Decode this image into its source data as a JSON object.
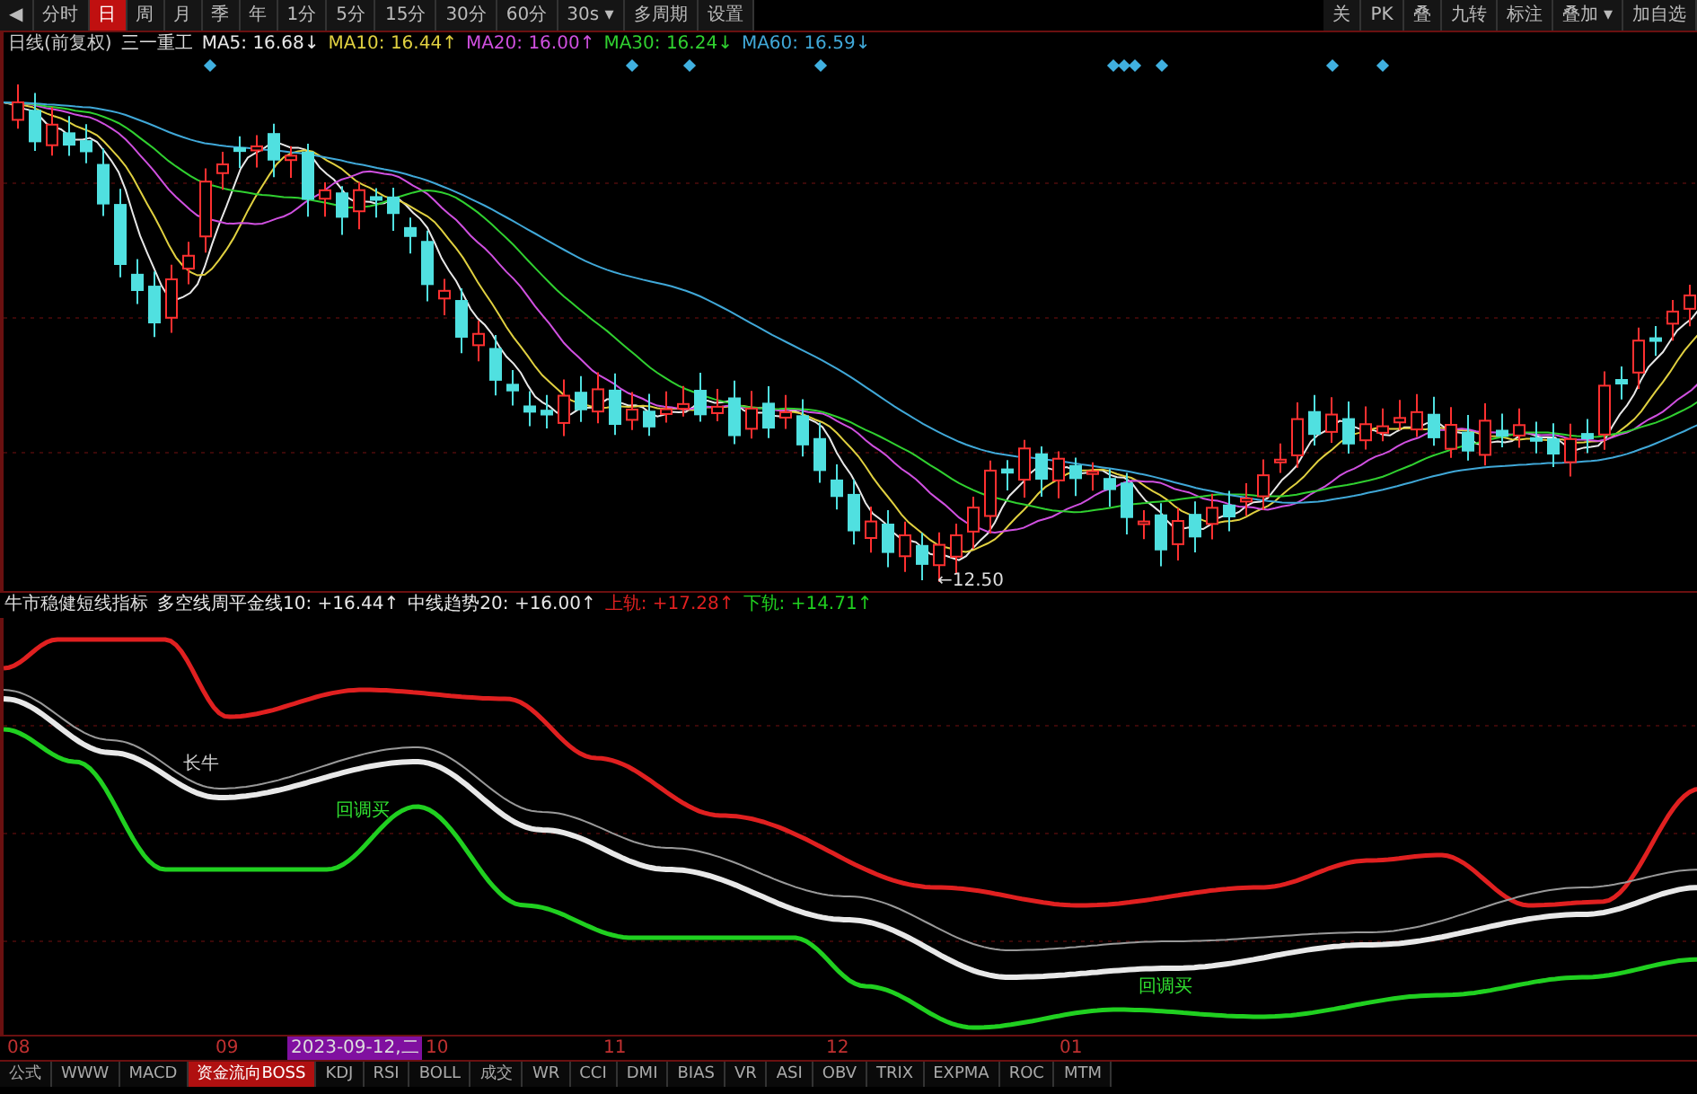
{
  "toolbar": {
    "left": [
      {
        "label": "◀",
        "selected": false
      },
      {
        "label": "分时",
        "selected": false
      },
      {
        "label": "日",
        "selected": true
      },
      {
        "label": "周",
        "selected": false
      },
      {
        "label": "月",
        "selected": false
      },
      {
        "label": "季",
        "selected": false
      },
      {
        "label": "年",
        "selected": false
      },
      {
        "label": "1分",
        "selected": false
      },
      {
        "label": "5分",
        "selected": false
      },
      {
        "label": "15分",
        "selected": false
      },
      {
        "label": "30分",
        "selected": false
      },
      {
        "label": "60分",
        "selected": false
      },
      {
        "label": "30s ▾",
        "selected": false
      },
      {
        "label": "多周期",
        "selected": false
      },
      {
        "label": "设置",
        "selected": false
      }
    ],
    "right": [
      "关",
      "PK",
      "叠",
      "九转",
      "标注",
      "叠加 ▾",
      "加自选"
    ]
  },
  "main_legend": {
    "mode": "日线(前复权)",
    "stock": "三一重工",
    "mas": [
      {
        "label": "MA5: 16.68",
        "arrow": "↓",
        "color": "#e8e8e8"
      },
      {
        "label": "MA10: 16.44",
        "arrow": "↑",
        "color": "#e0d040"
      },
      {
        "label": "MA20: 16.00",
        "arrow": "↑",
        "color": "#d050e0"
      },
      {
        "label": "MA30: 16.24",
        "arrow": "↓",
        "color": "#30d030"
      },
      {
        "label": "MA60: 16.59",
        "arrow": "↓",
        "color": "#40a8d8"
      }
    ]
  },
  "main_chart": {
    "low_label": "←12.50"
  },
  "indicator_legend": {
    "title": "牛市稳健短线指标",
    "items": [
      {
        "label": "多空线周平金线10: +16.44",
        "arrow": "↑",
        "color": "#e8e8e8"
      },
      {
        "label": "中线趋势20: +16.00",
        "arrow": "↑",
        "color": "#e8e8e8"
      },
      {
        "label": "上轨: +17.28",
        "arrow": "↑",
        "color": "#e02020"
      },
      {
        "label": "下轨: +14.71",
        "arrow": "↑",
        "color": "#20d020"
      }
    ]
  },
  "indicator_chart": {
    "annotations": [
      "长牛",
      "回调买",
      "回调买"
    ]
  },
  "x_axis": {
    "labels": [
      "08",
      "09",
      "10",
      "11",
      "12",
      "01"
    ],
    "cursor_date": "2023-09-12,二"
  },
  "bottom_tabs": [
    {
      "label": "公式",
      "selected": false
    },
    {
      "label": "WWW",
      "selected": false
    },
    {
      "label": "MACD",
      "selected": false
    },
    {
      "label": "资金流向BOSS",
      "selected": true
    },
    {
      "label": "KDJ",
      "selected": false
    },
    {
      "label": "RSI",
      "selected": false
    },
    {
      "label": "BOLL",
      "selected": false
    },
    {
      "label": "成交",
      "selected": false
    },
    {
      "label": "WR",
      "selected": false
    },
    {
      "label": "CCI",
      "selected": false
    },
    {
      "label": "DMI",
      "selected": false
    },
    {
      "label": "BIAS",
      "selected": false
    },
    {
      "label": "VR",
      "selected": false
    },
    {
      "label": "ASI",
      "selected": false
    },
    {
      "label": "OBV",
      "selected": false
    },
    {
      "label": "TRIX",
      "selected": false
    },
    {
      "label": "EXPMA",
      "selected": false
    },
    {
      "label": "ROC",
      "selected": false
    },
    {
      "label": "MTM",
      "selected": false
    }
  ]
}
